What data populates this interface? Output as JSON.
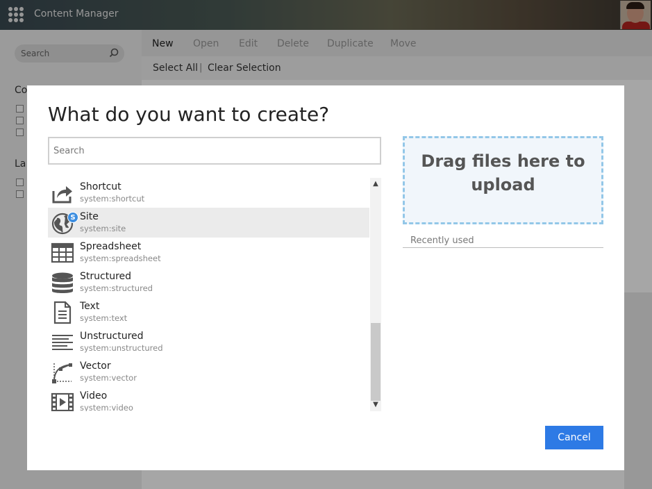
{
  "app": {
    "title": "Content Manager"
  },
  "sidebar": {
    "search_placeholder": "Search",
    "heading1": "Co",
    "heading2": "La"
  },
  "toolbar": {
    "buttons": [
      "New",
      "Open",
      "Edit",
      "Delete",
      "Duplicate",
      "Move"
    ]
  },
  "selection": {
    "select_all": "Select All",
    "separator": "|",
    "clear_selection": "Clear Selection"
  },
  "dialog": {
    "title": "What do you want to create?",
    "search_placeholder": "Search",
    "items": [
      {
        "name": "Shortcut",
        "type": "system:shortcut",
        "icon": "share-arrow-icon"
      },
      {
        "name": "Site",
        "type": "system:site",
        "icon": "globe-icon",
        "badge": "S",
        "selected": true
      },
      {
        "name": "Spreadsheet",
        "type": "system:spreadsheet",
        "icon": "grid-table-icon"
      },
      {
        "name": "Structured",
        "type": "system:structured",
        "icon": "database-icon"
      },
      {
        "name": "Text",
        "type": "system:text",
        "icon": "document-icon"
      },
      {
        "name": "Unstructured",
        "type": "system:unstructured",
        "icon": "text-lines-icon"
      },
      {
        "name": "Vector",
        "type": "system:vector",
        "icon": "vector-curve-icon"
      },
      {
        "name": "Video",
        "type": "system:video",
        "icon": "film-strip-icon"
      }
    ],
    "dropzone_text": "Drag files here to upload",
    "recently_used": "Recently used",
    "cancel": "Cancel"
  },
  "colors": {
    "accent": "#2d7ae5",
    "badge": "#3d8ee0",
    "dropzone_border": "#93c7e8",
    "dropzone_bg": "#f1f6fb"
  }
}
